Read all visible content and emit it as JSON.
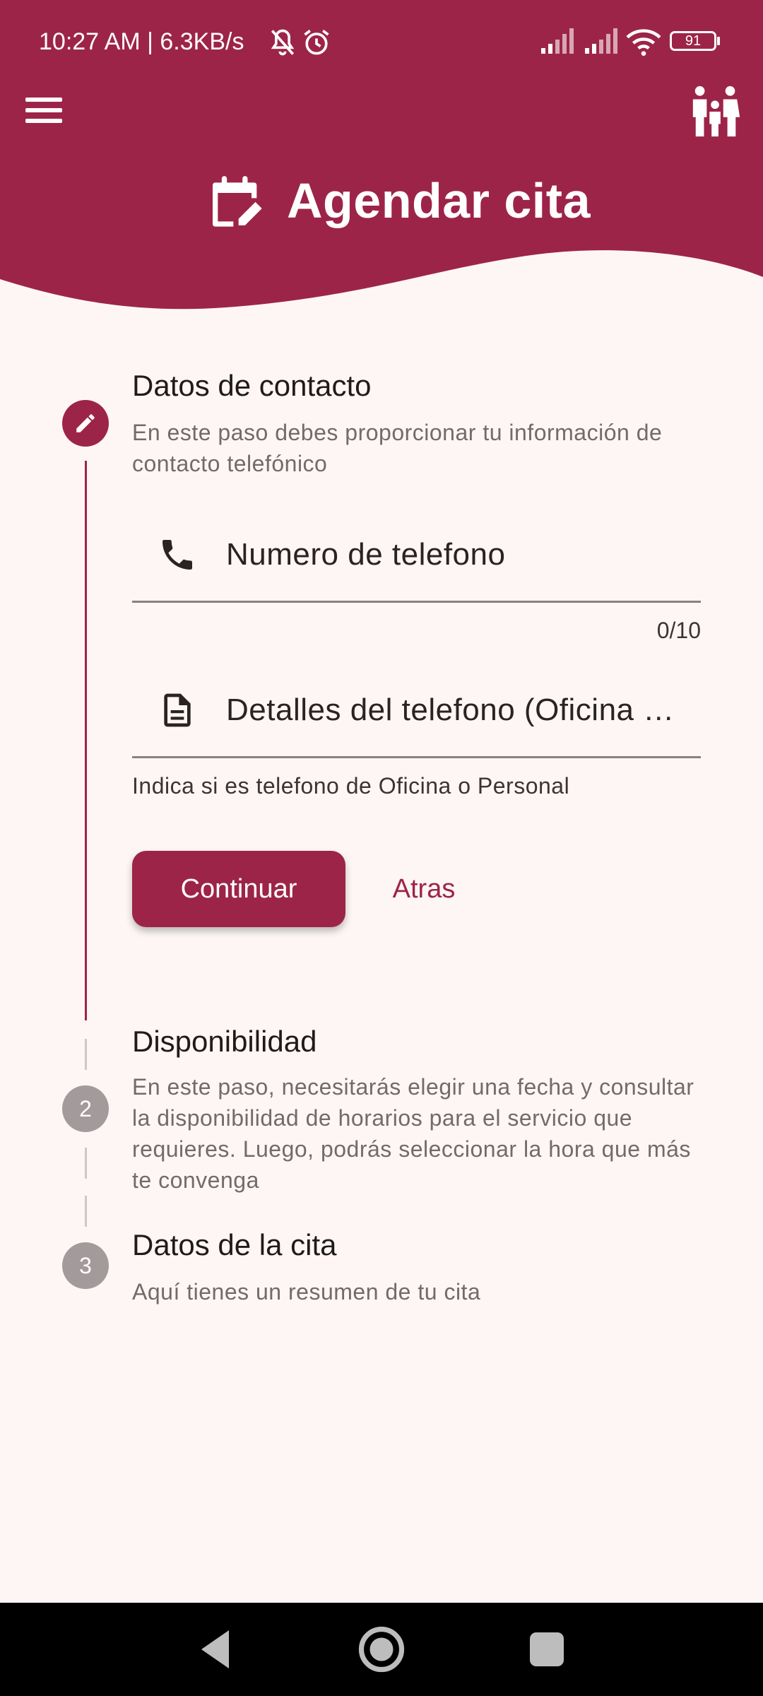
{
  "status_bar": {
    "time_speed": "10:27 AM | 6.3KB/s",
    "battery": "91",
    "icons": [
      "bell-off-icon",
      "alarm-icon",
      "signal-icon",
      "signal-icon",
      "wifi-icon",
      "battery-icon"
    ]
  },
  "header": {
    "title": "Agendar cita",
    "icons": [
      "menu-icon",
      "family-icon",
      "calendar-edit-icon"
    ],
    "color": "#9d2449"
  },
  "stepper": {
    "steps": [
      {
        "marker": "pencil-icon",
        "title": "Datos de contacto",
        "description": "En este paso debes proporcionar tu información de contacto telefónico",
        "state": "active"
      },
      {
        "marker": "2",
        "title": "Disponibilidad",
        "description": "En este paso, necesitarás elegir una fecha y consultar la disponibilidad de horarios para el servicio que requieres. Luego, podrás seleccionar la hora que más te convenga",
        "state": "pending"
      },
      {
        "marker": "3",
        "title": "Datos de la cita",
        "description": "Aquí tienes un resumen de tu cita",
        "state": "pending"
      }
    ]
  },
  "form": {
    "phone_placeholder": "Numero de telefono",
    "phone_icon": "phone-icon",
    "phone_counter": "0/10",
    "details_placeholder": "Detalles del telefono (Oficina o Personal)",
    "details_icon": "document-icon",
    "details_helper": "Indica si es telefono de Oficina o Personal"
  },
  "actions": {
    "continue_label": "Continuar",
    "back_label": "Atras"
  },
  "colors": {
    "accent": "#9d2449",
    "background": "#fdf6f4",
    "pending_circle": "#a39a9b"
  }
}
